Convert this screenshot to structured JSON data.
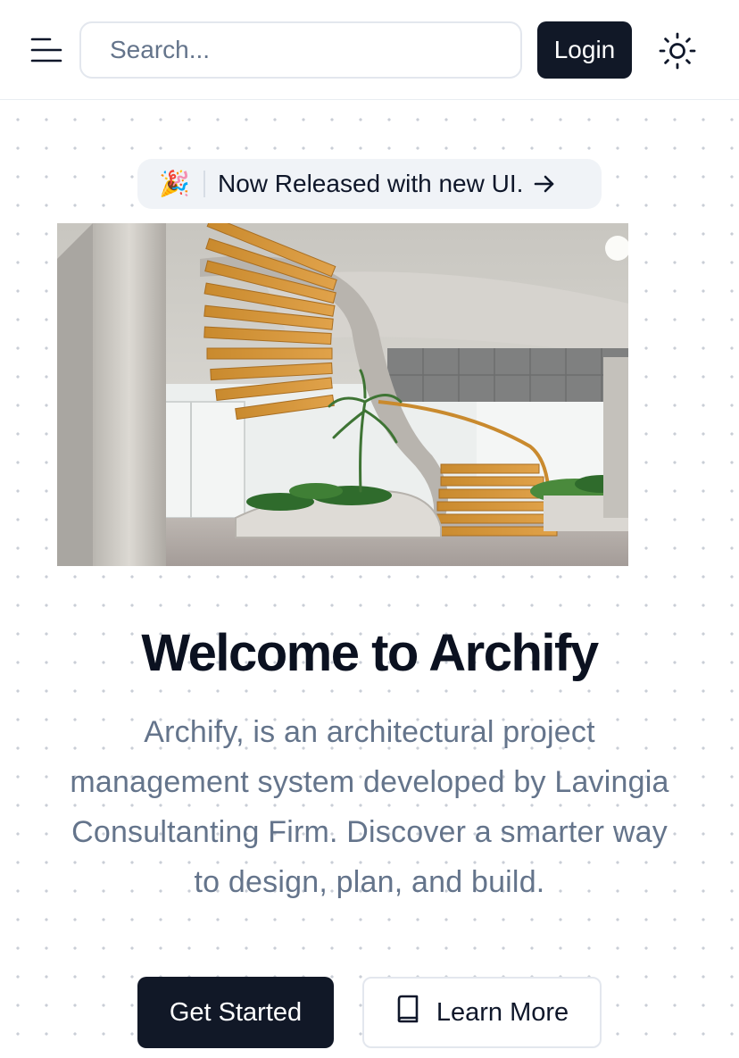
{
  "header": {
    "search_placeholder": "Search...",
    "login_label": "Login"
  },
  "announcement": {
    "emoji": "🎉",
    "text": "Now Released with new UI."
  },
  "hero": {
    "title": "Welcome to Archify",
    "description": "Archify, is an architectural project management system developed by Lavingia Consultanting Firm. Discover a smarter way to design, plan, and build.",
    "primary_cta": "Get Started",
    "secondary_cta": "Learn More"
  },
  "icons": {
    "menu": "menu-icon",
    "theme": "sun-icon",
    "arrow": "arrow-right-icon",
    "book": "book-icon"
  },
  "colors": {
    "primary": "#111827",
    "muted_text": "#64748b",
    "pill_bg": "#f0f3f7",
    "border": "#e3e7ee"
  }
}
